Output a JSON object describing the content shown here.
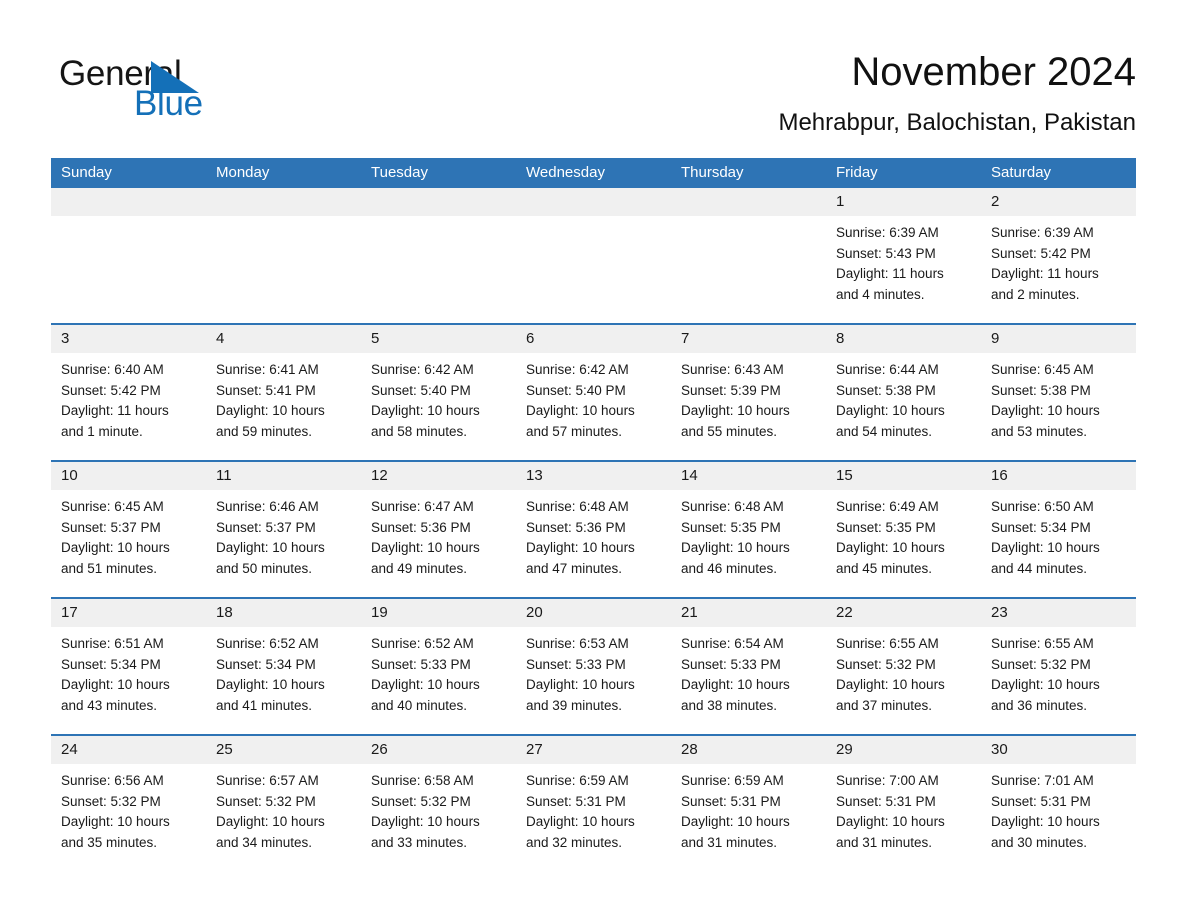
{
  "brand": {
    "name_part1": "General",
    "name_part2": "Blue",
    "triangle_icon": "triangle-icon",
    "accent_color": "#1470b8"
  },
  "header": {
    "month_title": "November 2024",
    "location": "Mehrabpur, Balochistan, Pakistan"
  },
  "calendar": {
    "header_bg": "#2e74b5",
    "daynum_bg": "#f0f0f0",
    "weekday_headers": [
      "Sunday",
      "Monday",
      "Tuesday",
      "Wednesday",
      "Thursday",
      "Friday",
      "Saturday"
    ],
    "labels": {
      "sunrise": "Sunrise:",
      "sunset": "Sunset:",
      "daylight": "Daylight:"
    },
    "weeks": [
      [
        {
          "day": "",
          "lines": []
        },
        {
          "day": "",
          "lines": []
        },
        {
          "day": "",
          "lines": []
        },
        {
          "day": "",
          "lines": []
        },
        {
          "day": "",
          "lines": []
        },
        {
          "day": "1",
          "lines": [
            "Sunrise: 6:39 AM",
            "Sunset: 5:43 PM",
            "Daylight: 11 hours",
            "and 4 minutes."
          ]
        },
        {
          "day": "2",
          "lines": [
            "Sunrise: 6:39 AM",
            "Sunset: 5:42 PM",
            "Daylight: 11 hours",
            "and 2 minutes."
          ]
        }
      ],
      [
        {
          "day": "3",
          "lines": [
            "Sunrise: 6:40 AM",
            "Sunset: 5:42 PM",
            "Daylight: 11 hours",
            "and 1 minute."
          ]
        },
        {
          "day": "4",
          "lines": [
            "Sunrise: 6:41 AM",
            "Sunset: 5:41 PM",
            "Daylight: 10 hours",
            "and 59 minutes."
          ]
        },
        {
          "day": "5",
          "lines": [
            "Sunrise: 6:42 AM",
            "Sunset: 5:40 PM",
            "Daylight: 10 hours",
            "and 58 minutes."
          ]
        },
        {
          "day": "6",
          "lines": [
            "Sunrise: 6:42 AM",
            "Sunset: 5:40 PM",
            "Daylight: 10 hours",
            "and 57 minutes."
          ]
        },
        {
          "day": "7",
          "lines": [
            "Sunrise: 6:43 AM",
            "Sunset: 5:39 PM",
            "Daylight: 10 hours",
            "and 55 minutes."
          ]
        },
        {
          "day": "8",
          "lines": [
            "Sunrise: 6:44 AM",
            "Sunset: 5:38 PM",
            "Daylight: 10 hours",
            "and 54 minutes."
          ]
        },
        {
          "day": "9",
          "lines": [
            "Sunrise: 6:45 AM",
            "Sunset: 5:38 PM",
            "Daylight: 10 hours",
            "and 53 minutes."
          ]
        }
      ],
      [
        {
          "day": "10",
          "lines": [
            "Sunrise: 6:45 AM",
            "Sunset: 5:37 PM",
            "Daylight: 10 hours",
            "and 51 minutes."
          ]
        },
        {
          "day": "11",
          "lines": [
            "Sunrise: 6:46 AM",
            "Sunset: 5:37 PM",
            "Daylight: 10 hours",
            "and 50 minutes."
          ]
        },
        {
          "day": "12",
          "lines": [
            "Sunrise: 6:47 AM",
            "Sunset: 5:36 PM",
            "Daylight: 10 hours",
            "and 49 minutes."
          ]
        },
        {
          "day": "13",
          "lines": [
            "Sunrise: 6:48 AM",
            "Sunset: 5:36 PM",
            "Daylight: 10 hours",
            "and 47 minutes."
          ]
        },
        {
          "day": "14",
          "lines": [
            "Sunrise: 6:48 AM",
            "Sunset: 5:35 PM",
            "Daylight: 10 hours",
            "and 46 minutes."
          ]
        },
        {
          "day": "15",
          "lines": [
            "Sunrise: 6:49 AM",
            "Sunset: 5:35 PM",
            "Daylight: 10 hours",
            "and 45 minutes."
          ]
        },
        {
          "day": "16",
          "lines": [
            "Sunrise: 6:50 AM",
            "Sunset: 5:34 PM",
            "Daylight: 10 hours",
            "and 44 minutes."
          ]
        }
      ],
      [
        {
          "day": "17",
          "lines": [
            "Sunrise: 6:51 AM",
            "Sunset: 5:34 PM",
            "Daylight: 10 hours",
            "and 43 minutes."
          ]
        },
        {
          "day": "18",
          "lines": [
            "Sunrise: 6:52 AM",
            "Sunset: 5:34 PM",
            "Daylight: 10 hours",
            "and 41 minutes."
          ]
        },
        {
          "day": "19",
          "lines": [
            "Sunrise: 6:52 AM",
            "Sunset: 5:33 PM",
            "Daylight: 10 hours",
            "and 40 minutes."
          ]
        },
        {
          "day": "20",
          "lines": [
            "Sunrise: 6:53 AM",
            "Sunset: 5:33 PM",
            "Daylight: 10 hours",
            "and 39 minutes."
          ]
        },
        {
          "day": "21",
          "lines": [
            "Sunrise: 6:54 AM",
            "Sunset: 5:33 PM",
            "Daylight: 10 hours",
            "and 38 minutes."
          ]
        },
        {
          "day": "22",
          "lines": [
            "Sunrise: 6:55 AM",
            "Sunset: 5:32 PM",
            "Daylight: 10 hours",
            "and 37 minutes."
          ]
        },
        {
          "day": "23",
          "lines": [
            "Sunrise: 6:55 AM",
            "Sunset: 5:32 PM",
            "Daylight: 10 hours",
            "and 36 minutes."
          ]
        }
      ],
      [
        {
          "day": "24",
          "lines": [
            "Sunrise: 6:56 AM",
            "Sunset: 5:32 PM",
            "Daylight: 10 hours",
            "and 35 minutes."
          ]
        },
        {
          "day": "25",
          "lines": [
            "Sunrise: 6:57 AM",
            "Sunset: 5:32 PM",
            "Daylight: 10 hours",
            "and 34 minutes."
          ]
        },
        {
          "day": "26",
          "lines": [
            "Sunrise: 6:58 AM",
            "Sunset: 5:32 PM",
            "Daylight: 10 hours",
            "and 33 minutes."
          ]
        },
        {
          "day": "27",
          "lines": [
            "Sunrise: 6:59 AM",
            "Sunset: 5:31 PM",
            "Daylight: 10 hours",
            "and 32 minutes."
          ]
        },
        {
          "day": "28",
          "lines": [
            "Sunrise: 6:59 AM",
            "Sunset: 5:31 PM",
            "Daylight: 10 hours",
            "and 31 minutes."
          ]
        },
        {
          "day": "29",
          "lines": [
            "Sunrise: 7:00 AM",
            "Sunset: 5:31 PM",
            "Daylight: 10 hours",
            "and 31 minutes."
          ]
        },
        {
          "day": "30",
          "lines": [
            "Sunrise: 7:01 AM",
            "Sunset: 5:31 PM",
            "Daylight: 10 hours",
            "and 30 minutes."
          ]
        }
      ]
    ]
  }
}
